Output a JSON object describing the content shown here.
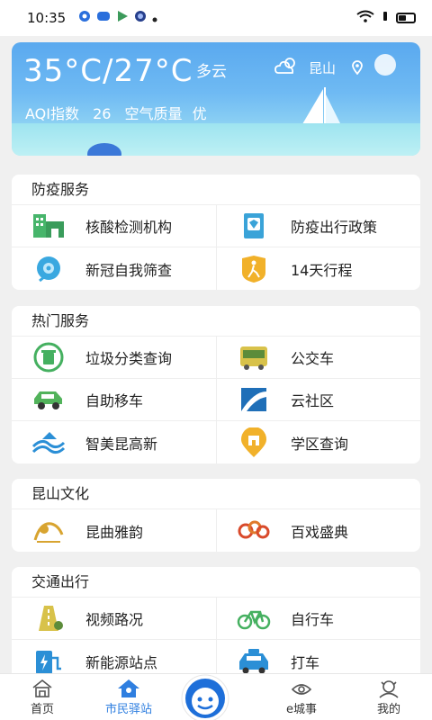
{
  "status_bar": {
    "time": "10:35"
  },
  "weather": {
    "temp": "35°C/27°C",
    "condition": "多云",
    "aqi_label": "AQI指数",
    "aqi_value": "26",
    "quality_label": "空气质量",
    "quality_value": "优",
    "city": "昆山"
  },
  "sections": [
    {
      "title": "防疫服务",
      "items": [
        {
          "label": "核酸检测机构",
          "icon": "hospital-building-icon"
        },
        {
          "label": "防疫出行政策",
          "icon": "policy-document-icon"
        },
        {
          "label": "新冠自我筛查",
          "icon": "virus-screening-icon"
        },
        {
          "label": "14天行程",
          "icon": "walking-person-icon"
        }
      ]
    },
    {
      "title": "热门服务",
      "items": [
        {
          "label": "垃圾分类查询",
          "icon": "recycle-bin-icon"
        },
        {
          "label": "公交车",
          "icon": "bus-icon"
        },
        {
          "label": "自助移车",
          "icon": "car-icon"
        },
        {
          "label": "云社区",
          "icon": "cloud-community-icon"
        },
        {
          "label": "智美昆高新",
          "icon": "smart-district-icon"
        },
        {
          "label": "学区查询",
          "icon": "school-district-icon"
        }
      ]
    },
    {
      "title": "昆山文化",
      "items": [
        {
          "label": "昆曲雅韵",
          "icon": "kunqu-opera-icon"
        },
        {
          "label": "百戏盛典",
          "icon": "opera-festival-icon"
        }
      ]
    },
    {
      "title": "交通出行",
      "items": [
        {
          "label": "视频路况",
          "icon": "road-camera-icon"
        },
        {
          "label": "自行车",
          "icon": "bicycle-icon"
        },
        {
          "label": "新能源站点",
          "icon": "charging-station-icon"
        },
        {
          "label": "打车",
          "icon": "taxi-icon"
        }
      ]
    }
  ],
  "tabs": [
    {
      "label": "首页",
      "icon": "home-icon"
    },
    {
      "label": "市民驿站",
      "icon": "citizen-station-icon",
      "active": true
    },
    {
      "label": "e城事",
      "icon": "e-city-icon"
    },
    {
      "label": "我的",
      "icon": "profile-icon"
    }
  ],
  "colors": {
    "accent": "#2f7fe0",
    "sky_top": "#5aa9ef",
    "sky_bottom": "#a7e3ee"
  }
}
